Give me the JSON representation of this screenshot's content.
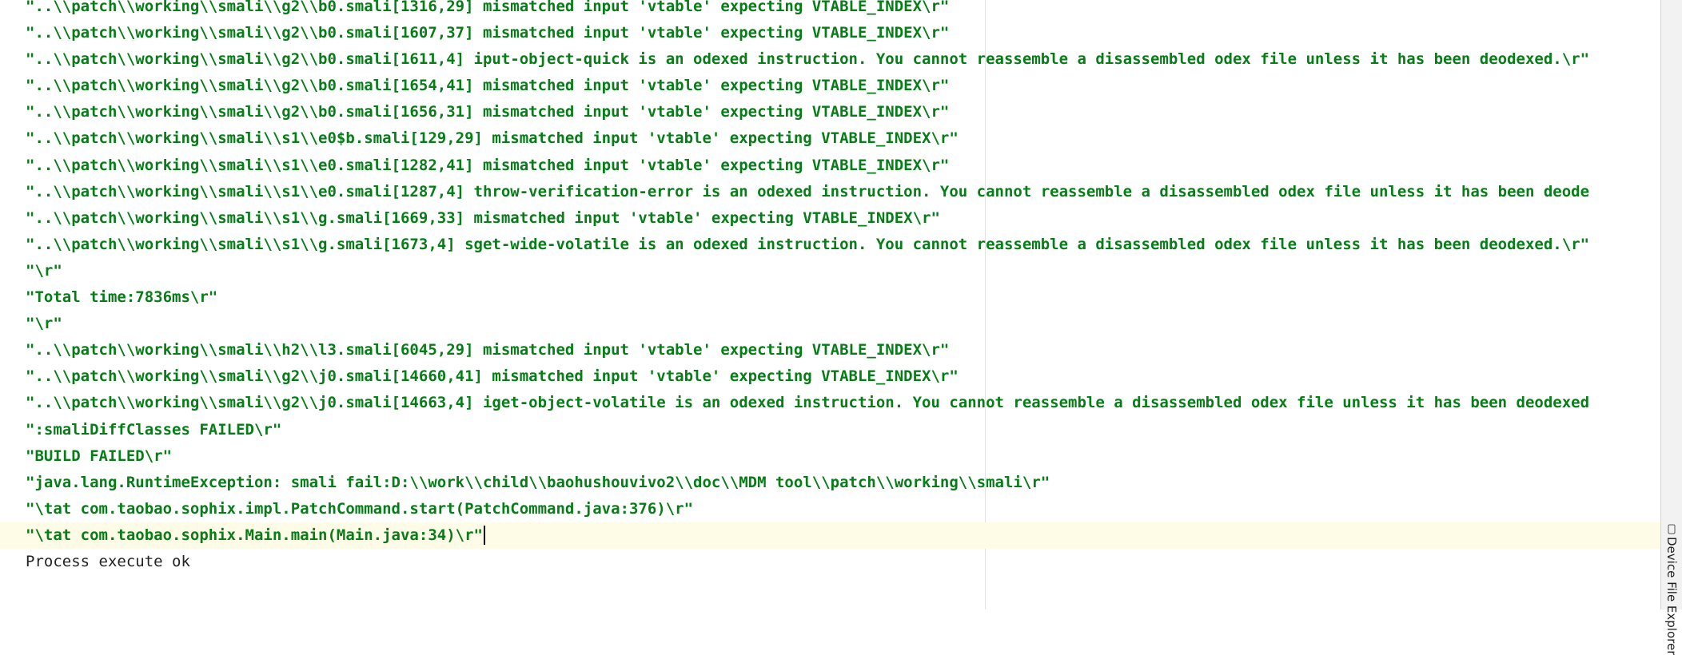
{
  "console": {
    "lines": [
      {
        "text": "\"..\\\\patch\\\\working\\\\smali\\\\g2\\\\b0.smali[1316,29] mismatched input 'vtable' expecting VTABLE_INDEX\\r\""
      },
      {
        "text": "\"..\\\\patch\\\\working\\\\smali\\\\g2\\\\b0.smali[1607,37] mismatched input 'vtable' expecting VTABLE_INDEX\\r\""
      },
      {
        "text": "\"..\\\\patch\\\\working\\\\smali\\\\g2\\\\b0.smali[1611,4] iput-object-quick is an odexed instruction. You cannot reassemble a disassembled odex file unless it has been deodexed.\\r\""
      },
      {
        "text": "\"..\\\\patch\\\\working\\\\smali\\\\g2\\\\b0.smali[1654,41] mismatched input 'vtable' expecting VTABLE_INDEX\\r\""
      },
      {
        "text": "\"..\\\\patch\\\\working\\\\smali\\\\g2\\\\b0.smali[1656,31] mismatched input 'vtable' expecting VTABLE_INDEX\\r\""
      },
      {
        "text": "\"..\\\\patch\\\\working\\\\smali\\\\s1\\\\e0$b.smali[129,29] mismatched input 'vtable' expecting VTABLE_INDEX\\r\""
      },
      {
        "text": "\"..\\\\patch\\\\working\\\\smali\\\\s1\\\\e0.smali[1282,41] mismatched input 'vtable' expecting VTABLE_INDEX\\r\""
      },
      {
        "text": "\"..\\\\patch\\\\working\\\\smali\\\\s1\\\\e0.smali[1287,4] throw-verification-error is an odexed instruction. You cannot reassemble a disassembled odex file unless it has been deode"
      },
      {
        "text": "\"..\\\\patch\\\\working\\\\smali\\\\s1\\\\g.smali[1669,33] mismatched input 'vtable' expecting VTABLE_INDEX\\r\""
      },
      {
        "text": "\"..\\\\patch\\\\working\\\\smali\\\\s1\\\\g.smali[1673,4] sget-wide-volatile is an odexed instruction. You cannot reassemble a disassembled odex file unless it has been deodexed.\\r\""
      },
      {
        "text": "\"\\r\""
      },
      {
        "text": "\"Total time:7836ms\\r\""
      },
      {
        "text": "\"\\r\""
      },
      {
        "text": "\"..\\\\patch\\\\working\\\\smali\\\\h2\\\\l3.smali[6045,29] mismatched input 'vtable' expecting VTABLE_INDEX\\r\""
      },
      {
        "text": "\"..\\\\patch\\\\working\\\\smali\\\\g2\\\\j0.smali[14660,41] mismatched input 'vtable' expecting VTABLE_INDEX\\r\""
      },
      {
        "text": "\"..\\\\patch\\\\working\\\\smali\\\\g2\\\\j0.smali[14663,4] iget-object-volatile is an odexed instruction. You cannot reassemble a disassembled odex file unless it has been deodexed"
      },
      {
        "text": "\":smaliDiffClasses FAILED\\r\""
      },
      {
        "text": "\"BUILD FAILED\\r\""
      },
      {
        "text": "\"java.lang.RuntimeException: smali fail:D:\\\\work\\\\child\\\\baohushouvivo2\\\\doc\\\\MDM tool\\\\patch\\\\working\\\\smali\\r\""
      },
      {
        "text": "\"\\tat com.taobao.sophix.impl.PatchCommand.start(PatchCommand.java:376)\\r\""
      },
      {
        "text": "\"\\tat com.taobao.sophix.Main.main(Main.java:34)\\r\""
      },
      {
        "text": "Process execute ok"
      }
    ]
  },
  "side_panel": {
    "tab_label": "Device File Explorer",
    "tab_icon": "device-icon"
  },
  "colors": {
    "output_text": "#067d17",
    "plain_text": "#222222",
    "current_line": "#fefbe6"
  }
}
